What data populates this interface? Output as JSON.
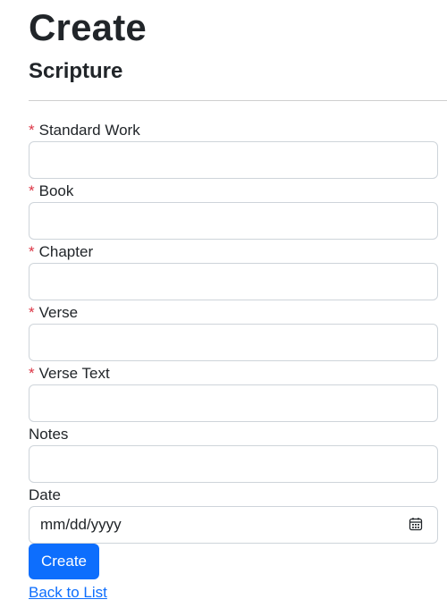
{
  "page": {
    "title": "Create",
    "subtitle": "Scripture"
  },
  "form": {
    "required_marker": "*",
    "fields": [
      {
        "label": "Standard Work",
        "value": "",
        "required": true
      },
      {
        "label": "Book",
        "value": "",
        "required": true
      },
      {
        "label": "Chapter",
        "value": "",
        "required": true
      },
      {
        "label": "Verse",
        "value": "",
        "required": true
      },
      {
        "label": "Verse Text",
        "value": "",
        "required": true
      },
      {
        "label": "Notes",
        "value": "",
        "required": false
      }
    ],
    "date": {
      "label": "Date",
      "placeholder": "mm/dd/yyyy",
      "icon": "calendar-icon"
    },
    "submit_label": "Create"
  },
  "back_link": {
    "label": "Back to List"
  },
  "colors": {
    "primary": "#0d6efd",
    "required": "#dc3545",
    "text": "#212529",
    "border": "#ced4da"
  }
}
